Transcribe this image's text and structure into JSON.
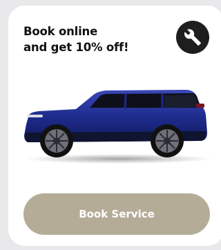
{
  "card": {
    "headline_line1": "Book online",
    "headline_line2": "and get 10% off!",
    "icon": "wrench-icon",
    "image": "suv-vehicle-image"
  },
  "actions": {
    "book_service_label": "Book Service"
  },
  "colors": {
    "background": "#e9e9eb",
    "card": "#ffffff",
    "icon_button": "#1e1e1e",
    "button": "#b5ac98",
    "car_body": "#1d2a8a"
  }
}
